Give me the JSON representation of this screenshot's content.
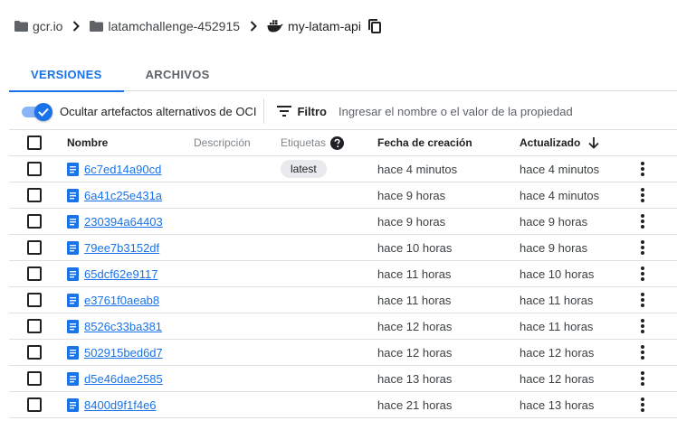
{
  "breadcrumb": {
    "items": [
      {
        "label": "gcr.io",
        "icon": "folder-icon"
      },
      {
        "label": "latamchallenge-452915",
        "icon": "folder-icon"
      },
      {
        "label": "my-latam-api",
        "icon": "docker-icon"
      }
    ],
    "copy_icon": "copy-icon"
  },
  "tabs": [
    {
      "label": "VERSIONES",
      "active": true
    },
    {
      "label": "ARCHIVOS",
      "active": false
    }
  ],
  "filterbar": {
    "toggle_label": "Ocultar artefactos alternativos de OCI",
    "toggle_on": true,
    "filter_label": "Filtro",
    "filter_placeholder": "Ingresar el nombre o el valor de la propiedad"
  },
  "table": {
    "headers": {
      "name": "Nombre",
      "description": "Descripción",
      "tags": "Etiquetas",
      "created": "Fecha de creación",
      "updated": "Actualizado"
    },
    "rows": [
      {
        "name": "6c7ed14a90cd",
        "tag": "latest",
        "created": "hace 4 minutos",
        "updated": "hace 4 minutos"
      },
      {
        "name": "6a41c25e431a",
        "tag": "",
        "created": "hace 9 horas",
        "updated": "hace 4 minutos"
      },
      {
        "name": "230394a64403",
        "tag": "",
        "created": "hace 9 horas",
        "updated": "hace 9 horas"
      },
      {
        "name": "79ee7b3152df",
        "tag": "",
        "created": "hace 10 horas",
        "updated": "hace 9 horas"
      },
      {
        "name": "65dcf62e9117",
        "tag": "",
        "created": "hace 11 horas",
        "updated": "hace 10 horas"
      },
      {
        "name": "e3761f0aeab8",
        "tag": "",
        "created": "hace 11 horas",
        "updated": "hace 11 horas"
      },
      {
        "name": "8526c33ba381",
        "tag": "",
        "created": "hace 12 horas",
        "updated": "hace 11 horas"
      },
      {
        "name": "502915bed6d7",
        "tag": "",
        "created": "hace 12 horas",
        "updated": "hace 12 horas"
      },
      {
        "name": "d5e46dae2585",
        "tag": "",
        "created": "hace 13 horas",
        "updated": "hace 12 horas"
      },
      {
        "name": "8400d9f1f4e6",
        "tag": "",
        "created": "hace 21 horas",
        "updated": "hace 13 horas"
      }
    ]
  },
  "colors": {
    "accent": "#1a73e8",
    "text": "#202124",
    "muted": "#5f6368",
    "divider": "#dadce0",
    "chip": "#e8eaed"
  }
}
